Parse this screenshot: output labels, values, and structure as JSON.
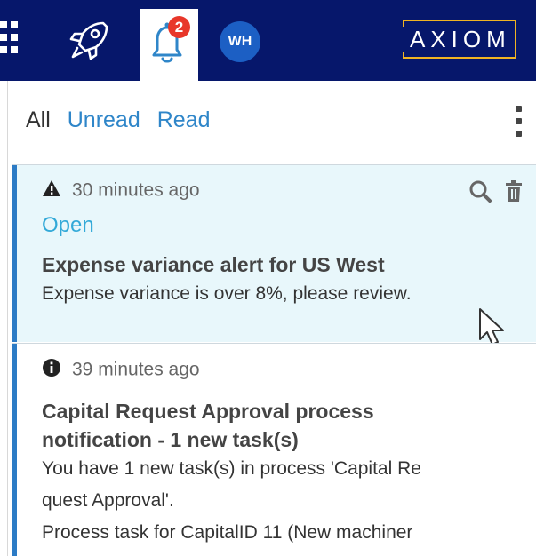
{
  "topbar": {
    "icons": [
      "apps-grid-icon",
      "rocket-icon",
      "bell-icon"
    ],
    "notification_count": "2",
    "avatar_initials": "WH",
    "logo_text": "AXIOM",
    "colors": {
      "bar": "#06176b",
      "logo_accent": "#f0b323",
      "badge": "#e8372a",
      "avatar": "#1c5fc4"
    }
  },
  "filters": {
    "all": "All",
    "unread": "Unread",
    "read": "Read"
  },
  "notifications": [
    {
      "icon": "warning-icon",
      "time": "30 minutes ago",
      "status": "Open",
      "title": "Expense variance alert for US West",
      "body": "Expense variance is over 8%, please review.",
      "actions": [
        "search-icon",
        "trash-icon"
      ]
    },
    {
      "icon": "info-icon",
      "time": "39 minutes ago",
      "title_line1": "Capital Request Approval process",
      "title_line2": "notification - 1 new task(s)",
      "body_line1": "You have 1 new task(s) in process 'Capital Re",
      "body_line2": "quest Approval'.",
      "body_line3": "Process task for CapitalID 11 (New machiner"
    }
  ],
  "colors": {
    "accent": "#2c7bc5",
    "link": "#2f86c9",
    "status_open": "#32a9d8",
    "selected_bg": "#e8f7fb"
  }
}
